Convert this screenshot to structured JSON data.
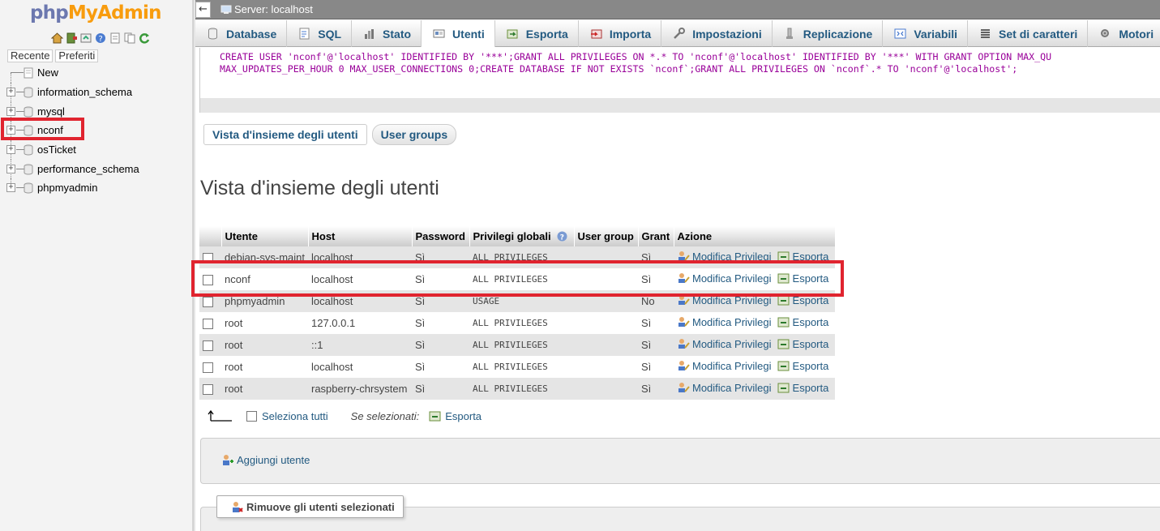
{
  "logo": {
    "php": "php",
    "myadmin": "MyAdmin"
  },
  "nav_links": [
    "Recente",
    "Preferiti"
  ],
  "tree": [
    {
      "label": "New",
      "type": "new"
    },
    {
      "label": "information_schema",
      "type": "db"
    },
    {
      "label": "mysql",
      "type": "db"
    },
    {
      "label": "nconf",
      "type": "db",
      "highlight": true
    },
    {
      "label": "osTicket",
      "type": "db"
    },
    {
      "label": "performance_schema",
      "type": "db"
    },
    {
      "label": "phpmyadmin",
      "type": "db"
    }
  ],
  "server": {
    "back": "←",
    "label": "Server: localhost"
  },
  "tabs": [
    {
      "label": "Database",
      "icon": "database-icon"
    },
    {
      "label": "SQL",
      "icon": "sql-icon"
    },
    {
      "label": "Stato",
      "icon": "status-icon"
    },
    {
      "label": "Utenti",
      "icon": "users-icon",
      "active": true
    },
    {
      "label": "Esporta",
      "icon": "export-icon"
    },
    {
      "label": "Importa",
      "icon": "import-icon"
    },
    {
      "label": "Impostazioni",
      "icon": "wrench-icon"
    },
    {
      "label": "Replicazione",
      "icon": "replication-icon"
    },
    {
      "label": "Variabili",
      "icon": "variables-icon"
    },
    {
      "label": "Set di caratteri",
      "icon": "charset-icon"
    },
    {
      "label": "Motori",
      "icon": "engines-icon"
    }
  ],
  "sql": {
    "line1": "CREATE USER 'nconf'@'localhost' IDENTIFIED BY '***';GRANT ALL PRIVILEGES ON *.* TO 'nconf'@'localhost' IDENTIFIED BY '***' WITH GRANT OPTION MAX_QU",
    "line2": "MAX_UPDATES_PER_HOUR 0 MAX_USER_CONNECTIONS 0;CREATE DATABASE IF NOT EXISTS `nconf`;GRANT ALL PRIVILEGES ON `nconf`.* TO 'nconf'@'localhost';"
  },
  "subtabs": [
    "Vista d'insieme degli utenti",
    "User groups"
  ],
  "heading": "Vista d'insieme degli utenti",
  "table": {
    "headers": [
      "Utente",
      "Host",
      "Password",
      "Privilegi globali",
      "User group",
      "Grant",
      "Azione"
    ],
    "action_edit": "Modifica Privilegi",
    "action_export": "Esporta",
    "rows": [
      {
        "user": "debian-sys-maint",
        "host": "localhost",
        "password": "Sì",
        "privs": "ALL PRIVILEGES",
        "group": "",
        "grant": "Sì"
      },
      {
        "user": "nconf",
        "host": "localhost",
        "password": "Sì",
        "privs": "ALL PRIVILEGES",
        "group": "",
        "grant": "Sì",
        "highlight": true
      },
      {
        "user": "phpmyadmin",
        "host": "localhost",
        "password": "Sì",
        "privs": "USAGE",
        "group": "",
        "grant": "No"
      },
      {
        "user": "root",
        "host": "127.0.0.1",
        "password": "Sì",
        "privs": "ALL PRIVILEGES",
        "group": "",
        "grant": "Sì"
      },
      {
        "user": "root",
        "host": "::1",
        "password": "Sì",
        "privs": "ALL PRIVILEGES",
        "group": "",
        "grant": "Sì"
      },
      {
        "user": "root",
        "host": "localhost",
        "password": "Sì",
        "privs": "ALL PRIVILEGES",
        "group": "",
        "grant": "Sì"
      },
      {
        "user": "root",
        "host": "raspberry-chrsystem",
        "password": "Sì",
        "privs": "ALL PRIVILEGES",
        "group": "",
        "grant": "Sì"
      }
    ]
  },
  "bulk": {
    "select_all": "Seleziona tutti",
    "with_selected": "Se selezionati:",
    "export": "Esporta"
  },
  "add_user": "Aggiungi utente",
  "remove_selected": "Rimuove gli utenti selezionati",
  "colors": {
    "link": "#235a81",
    "highlight": "#e0242f",
    "logo_php": "#6c78af",
    "logo_myadmin": "#f89c0e"
  }
}
